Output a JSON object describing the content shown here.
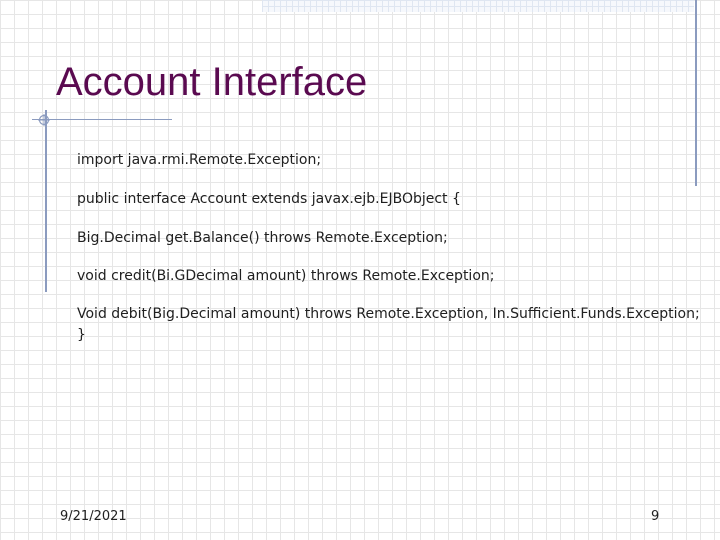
{
  "slide": {
    "title": "Account Interface",
    "code_lines": [
      "import java.rmi.Remote.Exception;",
      "public interface Account extends javax.ejb.EJBObject {",
      "Big.Decimal get.Balance() throws Remote.Exception;",
      "void credit(Bi.GDecimal amount) throws Remote.Exception;",
      "Void debit(Big.Decimal amount) throws Remote.Exception, In.Sufficient.Funds.Exception;",
      "}"
    ],
    "footer": {
      "date": "9/21/2021",
      "page_number": "9"
    }
  },
  "colors": {
    "title": "#5a0a50",
    "accent_rule": "#8b9bbf",
    "grid": "#e6e6e6",
    "text": "#202020"
  }
}
